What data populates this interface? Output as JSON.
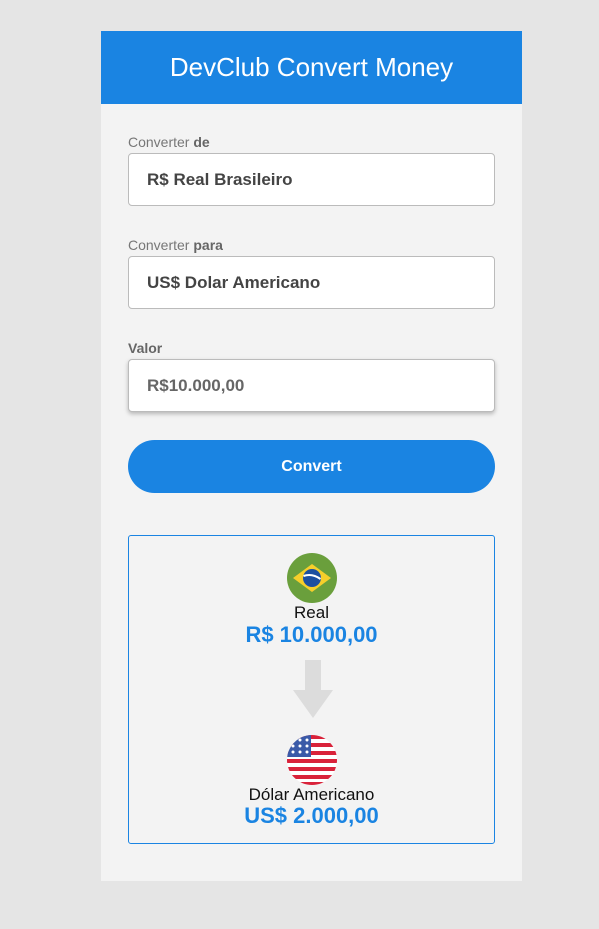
{
  "header": {
    "title": "DevClub Convert Money"
  },
  "form": {
    "from_label": "Converter",
    "from_label_bold": "de",
    "from_value": "R$ Real Brasileiro",
    "to_label": "Converter",
    "to_label_bold": "para",
    "to_value": "US$ Dolar Americano",
    "amount_label": "Valor",
    "amount_value": "R$10.000,00",
    "convert_label": "Convert"
  },
  "result": {
    "from_name": "Real",
    "from_amount": "R$ 10.000,00",
    "to_name": "Dólar Americano",
    "to_amount": "US$ 2.000,00"
  },
  "colors": {
    "accent": "#1a84e2"
  }
}
